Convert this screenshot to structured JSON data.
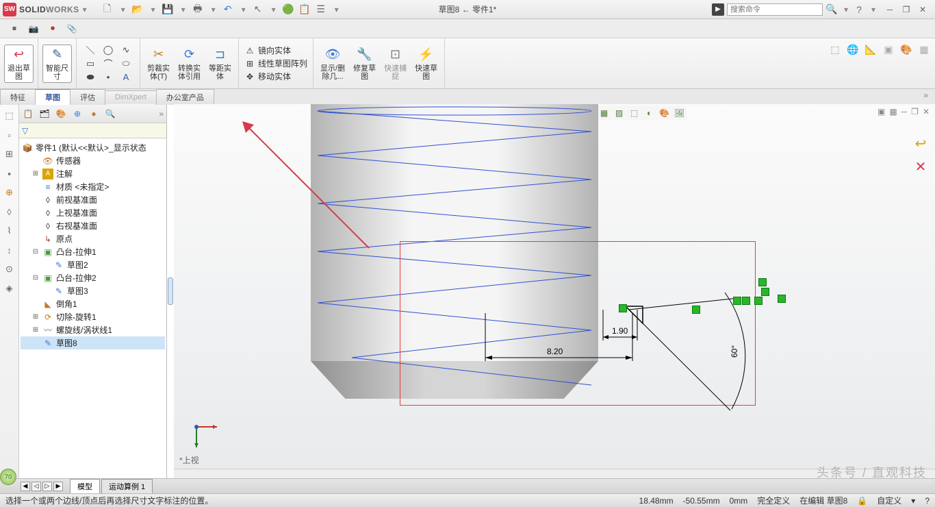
{
  "brand": "SOLIDWORKS",
  "doc_title": "草图8 ← 零件1*",
  "search_placeholder": "搜索命令",
  "ribbon": {
    "exit_sketch": "退出草\n图",
    "smart_dim": "智能尺\n寸",
    "trim": "剪裁实\n体(T)",
    "convert": "转换实\n体引用",
    "offset": "等距实\n体",
    "mirror": "镜向实体",
    "pattern": "线性草图阵列",
    "move": "移动实体",
    "show_hide": "显示/删\n除几...",
    "repair": "修复草\n图",
    "quick_snap": "快速捕\n捉",
    "quick_sketch": "快速草\n图"
  },
  "tabs": {
    "features": "特征",
    "sketch": "草图",
    "evaluate": "评估",
    "dimx": "DimXpert",
    "office": "办公室产品"
  },
  "tree": {
    "root": "零件1 (默认<<默认>_显示状态",
    "sensors": "传感器",
    "annotations": "注解",
    "material": "材质 <未指定>",
    "front": "前视基准面",
    "top": "上视基准面",
    "right": "右视基准面",
    "origin": "原点",
    "boss1": "凸台-拉伸1",
    "sk2": "草图2",
    "boss2": "凸台-拉伸2",
    "sk3": "草图3",
    "chamfer": "倒角1",
    "cutrev": "切除-旋转1",
    "helix": "螺旋线/涡状线1",
    "sk8": "草图8"
  },
  "dims": {
    "d1": "8.20",
    "d2": "1.90",
    "ang": "60°"
  },
  "view_label": "*上视",
  "model_tabs": {
    "model": "模型",
    "motion": "运动算例 1"
  },
  "status": {
    "hint": "选择一个或两个边线/顶点后再选择尺寸文字标注的位置。",
    "x": "18.48mm",
    "y": "-50.55mm",
    "z": "0mm",
    "def": "完全定义",
    "edit": "在编辑 草图8",
    "custom": "自定义"
  },
  "odometer": "70",
  "watermark": "头条号 / 直观科技"
}
